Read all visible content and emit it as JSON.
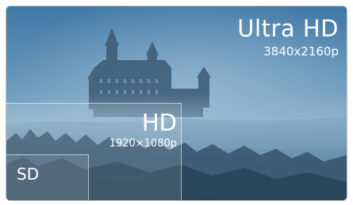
{
  "ultra_hd": {
    "title": "Ultra HD",
    "resolution": "3840x2160p"
  },
  "hd": {
    "title": "HD",
    "resolution": "1920×1080p"
  },
  "sd": {
    "title": "SD"
  }
}
